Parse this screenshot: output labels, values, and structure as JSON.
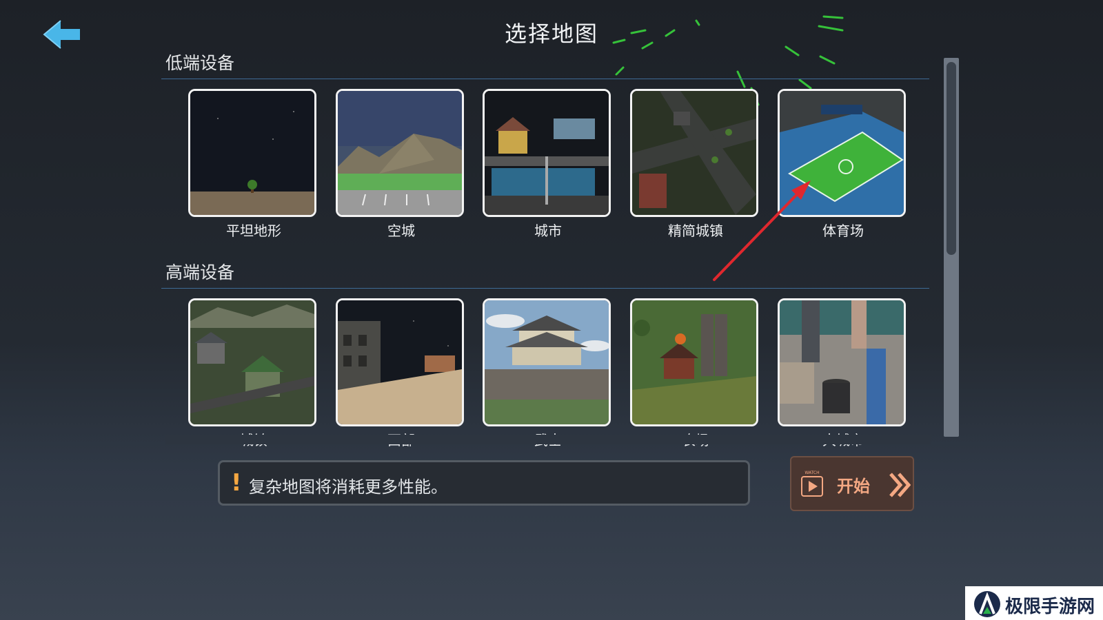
{
  "header": {
    "title": "选择地图",
    "back_icon": "back-arrow-icon"
  },
  "sections": {
    "low": {
      "heading": "低端设备",
      "maps": [
        {
          "label": "平坦地形",
          "icon": "flat-terrain-thumbnail"
        },
        {
          "label": "空城",
          "icon": "empty-city-thumbnail"
        },
        {
          "label": "城市",
          "icon": "city-thumbnail"
        },
        {
          "label": "精简城镇",
          "icon": "simple-town-thumbnail"
        },
        {
          "label": "体育场",
          "icon": "stadium-thumbnail"
        }
      ]
    },
    "high": {
      "heading": "高端设备",
      "maps": [
        {
          "label": "城镇",
          "icon": "town-thumbnail"
        },
        {
          "label": "西部",
          "icon": "western-thumbnail"
        },
        {
          "label": "武士",
          "icon": "samurai-thumbnail"
        },
        {
          "label": "农场",
          "icon": "farm-thumbnail"
        },
        {
          "label": "大城市",
          "icon": "big-city-thumbnail"
        }
      ]
    }
  },
  "notice": {
    "mark": "!",
    "text": "复杂地图将消耗更多性能。"
  },
  "start_button": {
    "label": "开始",
    "watch_text": "WATCH"
  },
  "watermark": {
    "text": "极限手游网"
  },
  "colors": {
    "accent_blue": "#49b6e8",
    "warning": "#f4a742",
    "start_text": "#f4a883",
    "annotation_arrow": "#e0282e"
  }
}
